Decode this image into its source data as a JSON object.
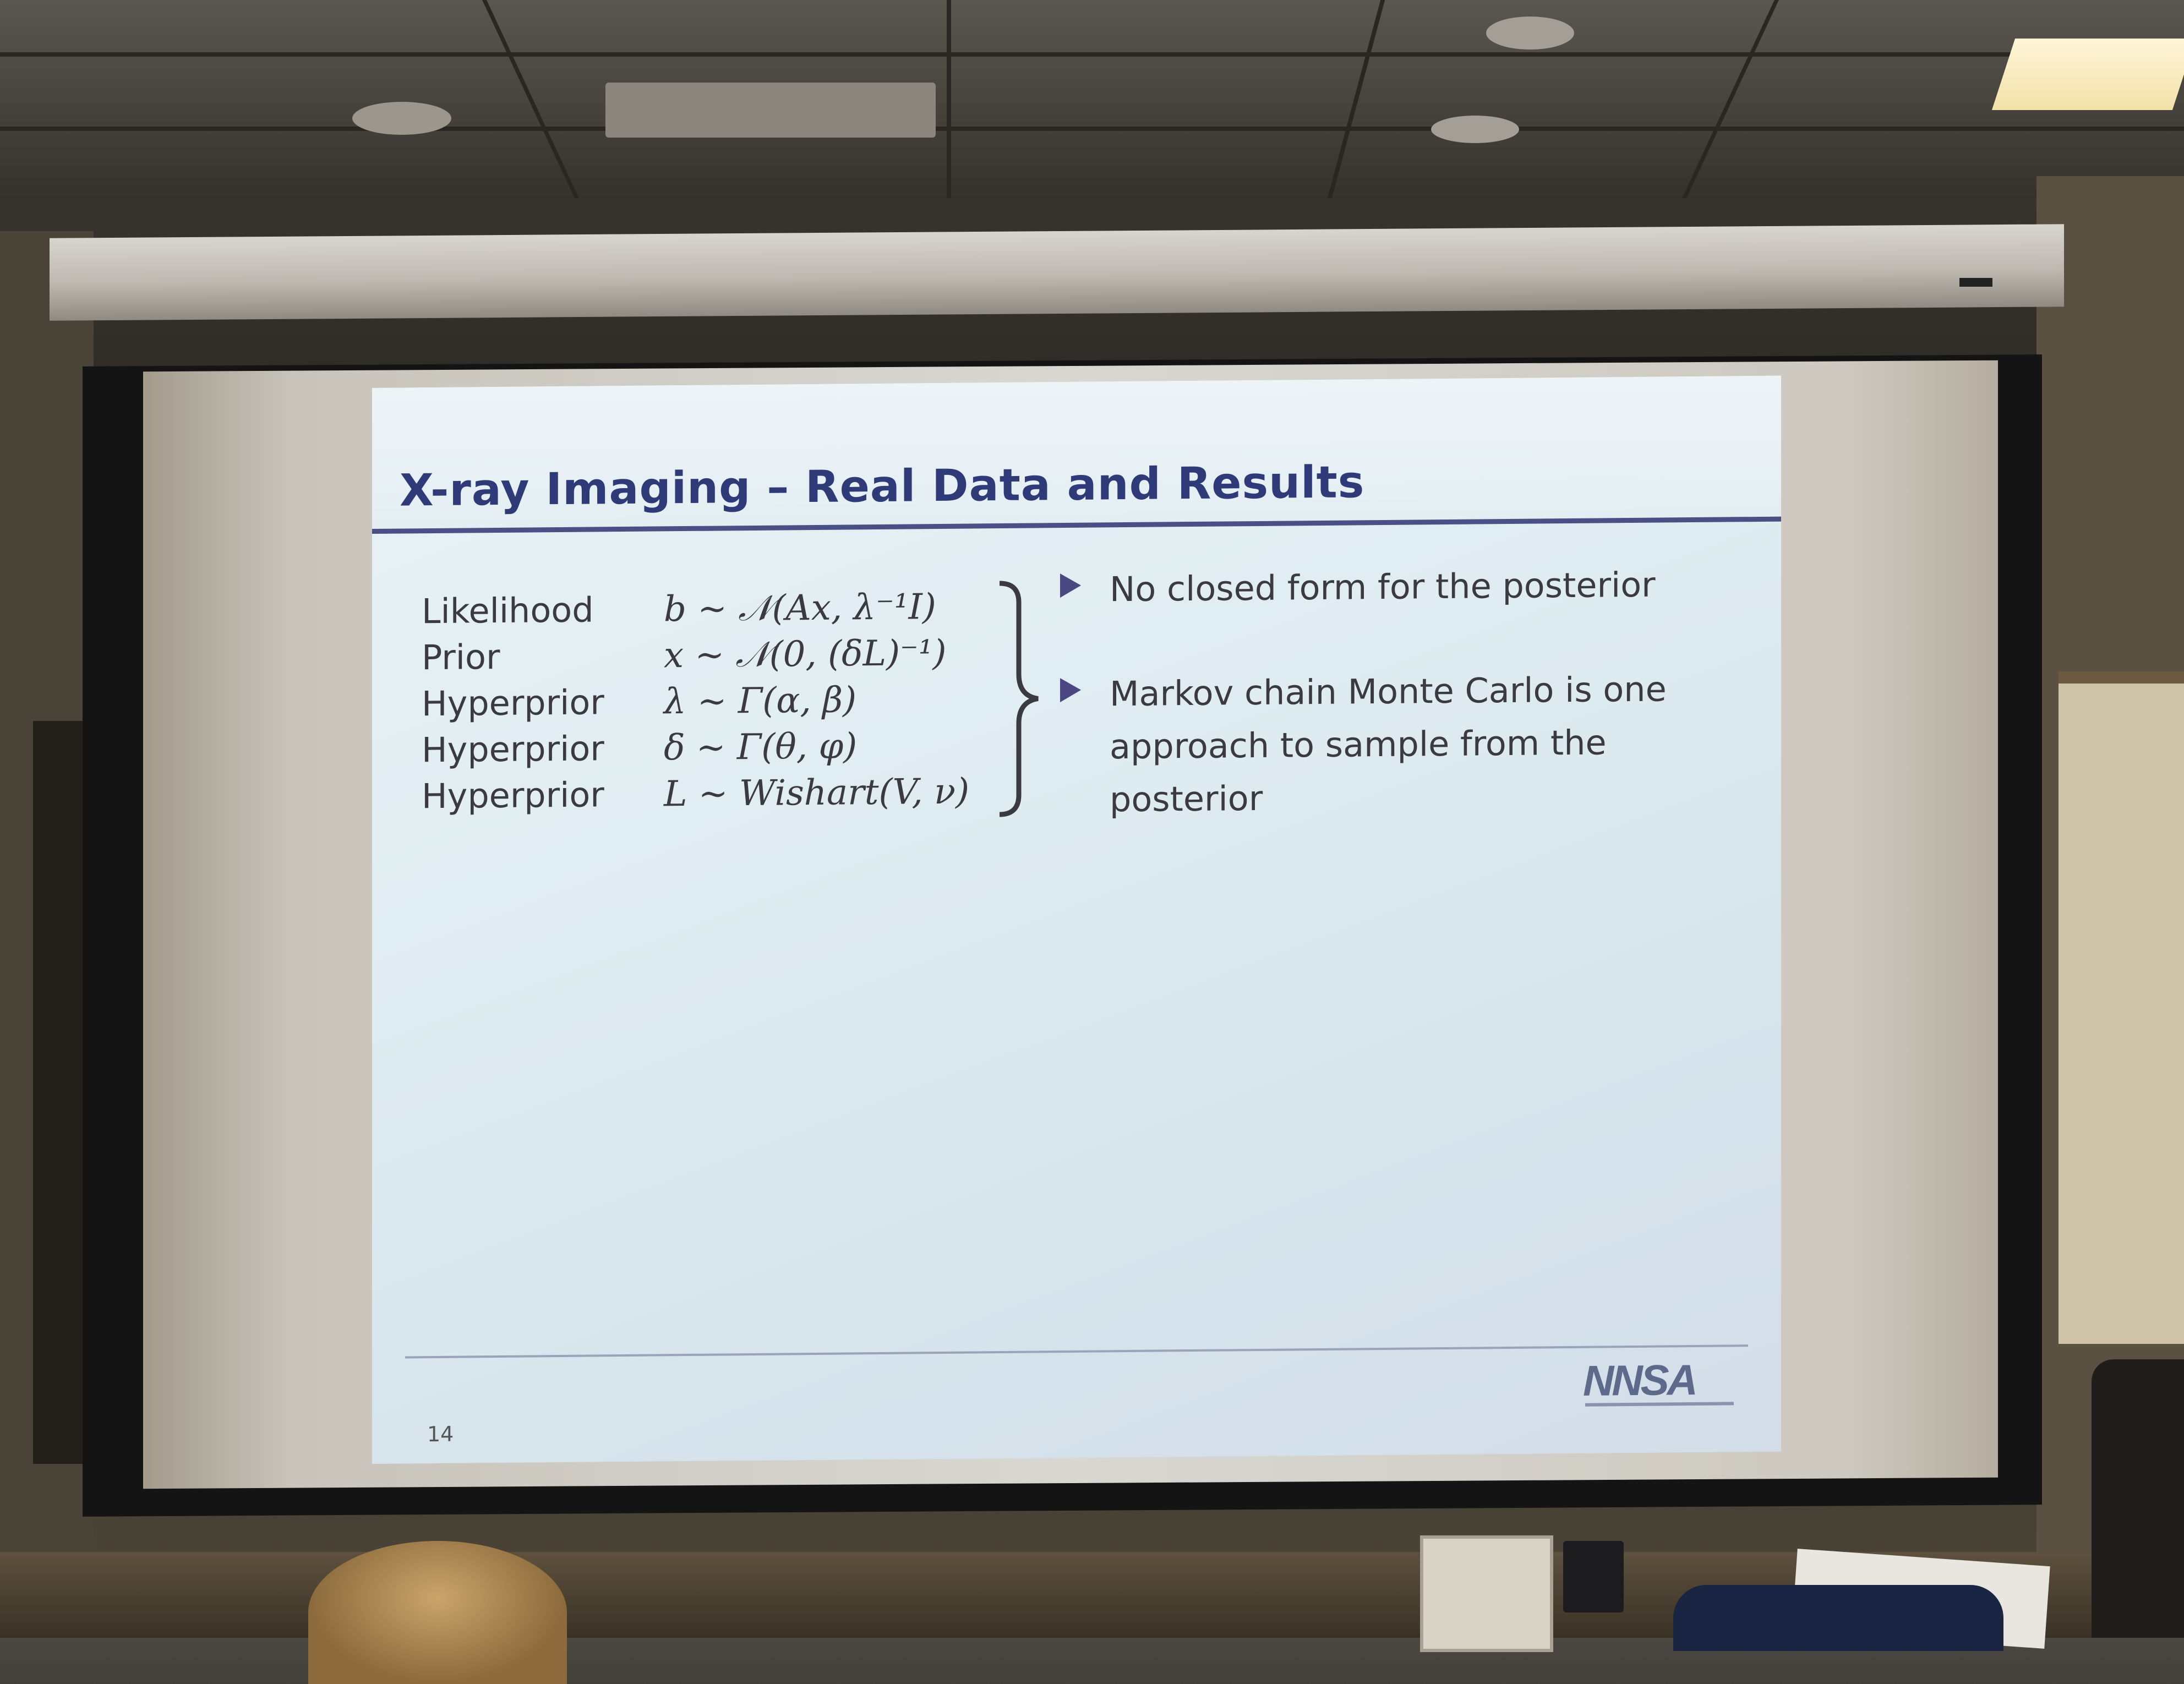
{
  "slide": {
    "title": "X-ray Imaging – Real Data and Results",
    "model": [
      {
        "label": "Likelihood",
        "formula": "b ∼ 𝒩(Ax, λ⁻¹I)"
      },
      {
        "label": "Prior",
        "formula": "x ∼ 𝒩(0, (δL)⁻¹)"
      },
      {
        "label": "Hyperprior",
        "formula": "λ ∼ Γ(α, β)"
      },
      {
        "label": "Hyperprior",
        "formula": "δ ∼ Γ(θ, φ)"
      },
      {
        "label": "Hyperprior",
        "formula": "L ∼ Wishart(V, ν)"
      }
    ],
    "bullets": [
      "No closed form for the posterior",
      "Markov chain Monte Carlo is one approach to sample from the posterior"
    ],
    "page_number": "14",
    "logo_text": "NNSA",
    "accent_color": "#2f3a78",
    "bullet_color": "#4b4782"
  }
}
